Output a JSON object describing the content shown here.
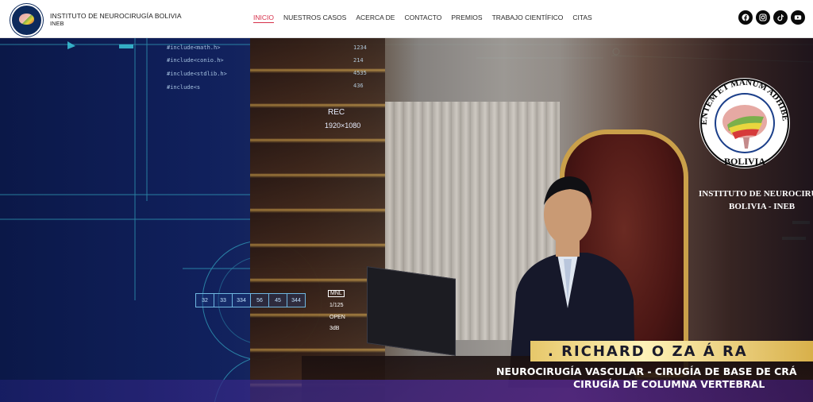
{
  "brand": {
    "name": "INSTITUTO DE NEUROCIRUGÍA BOLIVIA",
    "short": "INEB",
    "logo_icon": "brain-logo-icon"
  },
  "nav": {
    "items": [
      {
        "label": "INICIO",
        "active": true
      },
      {
        "label": "NUESTROS CASOS",
        "active": false
      },
      {
        "label": "ACERCA DE",
        "active": false
      },
      {
        "label": "CONTACTO",
        "active": false
      },
      {
        "label": "PREMIOS",
        "active": false
      },
      {
        "label": "TRABAJO CIENTÍFICO",
        "active": false
      },
      {
        "label": "CITAS",
        "active": false
      }
    ],
    "active_color": "#d6304a"
  },
  "socials": [
    {
      "name": "facebook-icon"
    },
    {
      "name": "instagram-icon"
    },
    {
      "name": "tiktok-icon"
    },
    {
      "name": "youtube-icon"
    }
  ],
  "hero": {
    "hud": {
      "code_lines": [
        "#include<math.h>",
        "#include<conio.h>",
        "#include<stdlib.h>",
        "#include<s"
      ],
      "rec": "REC",
      "resolution": "1920×1080",
      "camera_mode": "MNL",
      "shutter": "1/125",
      "aperture": "OPEN",
      "gain": "3dB",
      "ticks": [
        "32",
        "33",
        "334",
        "56",
        "45",
        "344"
      ],
      "numbers": [
        "1234",
        "214",
        "4535",
        "436"
      ]
    },
    "emblem": {
      "motto": "MENTEM ET MANUM ADHIBERE",
      "country": "BOLIVIA",
      "title_line1": "INSTITUTO DE NEUROCIRUGÍA",
      "title_line2": "BOLIVIA - INEB"
    },
    "doctor_name": ". RICHARD  O ZA  Á RA",
    "specialty_line1": "NEUROCIRUGÍA VASCULAR - CIRUGÍA DE BASE DE CRÁ",
    "specialty_line2": "CIRUGÍA DE COLUMNA VERTEBRAL"
  }
}
